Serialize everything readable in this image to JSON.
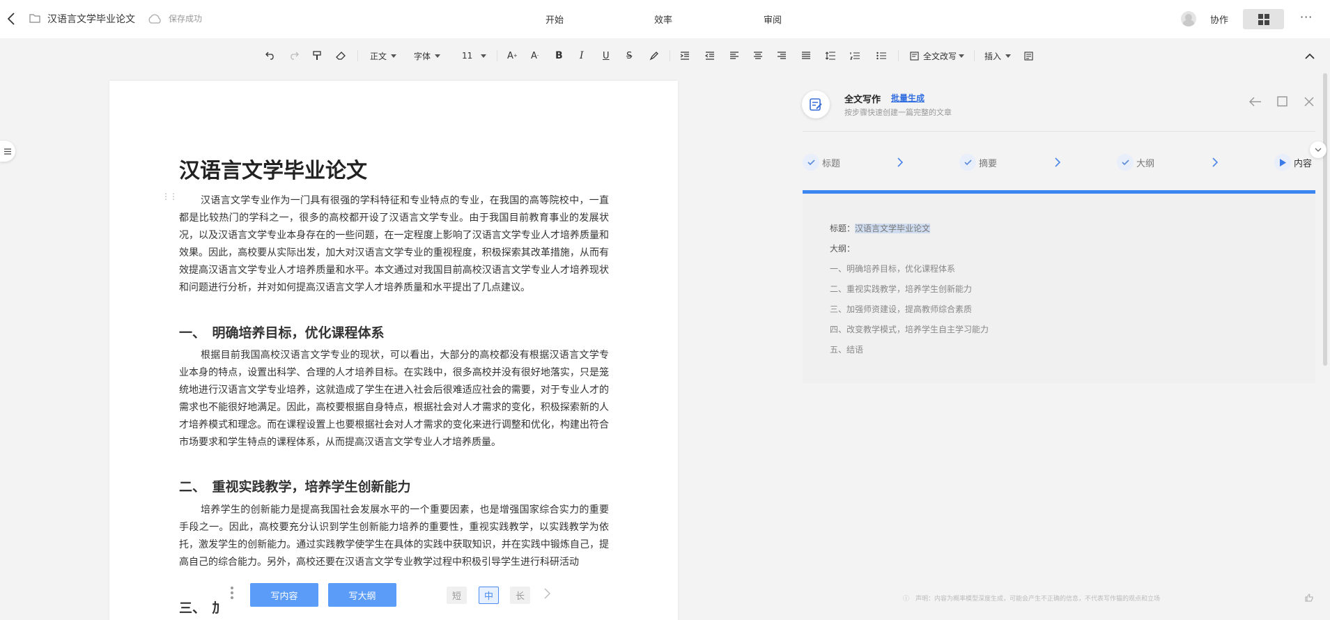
{
  "topbar": {
    "doc_title": "汉语言文学毕业论文",
    "save_status": "保存成功",
    "tabs": [
      "开始",
      "效率",
      "审阅"
    ],
    "collab": "协作"
  },
  "toolbar": {
    "style": "正文",
    "font": "字体",
    "size": "11",
    "rewrite": "全文改写",
    "insert": "插入"
  },
  "document": {
    "title": "汉语言文学毕业论文",
    "intro": "汉语言文学专业作为一门具有很强的学科特征和专业特点的专业，在我国的高等院校中，一直都是比较热门的学科之一，很多的高校都开设了汉语言文学专业。由于我国目前教育事业的发展状况，以及汉语言文学专业本身存在的一些问题，在一定程度上影响了汉语言文学专业人才培养质量和效果。因此，高校要从实际出发，加大对汉语言文学专业的重视程度，积极探索其改革措施，从而有效提高汉语言文学专业人才培养质量和水平。本文通过对我国目前高校汉语言文学专业人才培养现状和问题进行分析，并对如何提高汉语言文学人才培养质量和水平提出了几点建议。",
    "sec1_title": "一、　明确培养目标，优化课程体系",
    "sec1_text": "根据目前我国高校汉语言文学专业的现状，可以看出，大部分的高校都没有根据汉语言文学专业本身的特点，设置出科学、合理的人才培养目标。在实践中，很多高校并没有很好地落实，只是笼统地进行汉语言文学专业培养，这就造成了学生在进入社会后很难适应社会的需要，对于专业人才的需求也不能很好地满足。因此，高校要根据自身特点，根据社会对人才需求的变化，积极探索新的人才培养模式和理念。而在课程设置上也要根据社会对人才需求的变化来进行调整和优化，构建出符合市场要求和学生特点的课程体系，从而提高汉语言文学专业人才培养质量。",
    "sec2_title": "二、　重视实践教学，培养学生创新能力",
    "sec2_text": "培养学生的创新能力是提高我国社会发展水平的一个重要因素，也是增强国家综合实力的重要手段之一。因此，高校要充分认识到学生创新能力培养的重要性，重视实践教学，以实践教学为依托，激发学生的创新能力。通过实践教学使学生在具体的实践中获取知识，并在实践中锻炼自己，提高自己的综合能力。另外，高校还要在汉语言文学专业教学过程中积极引导学生进行科研活动",
    "sec3_title": "三、　加"
  },
  "float_bar": {
    "write_content": "写内容",
    "write_outline": "写大纲",
    "short": "短",
    "medium": "中",
    "long": "长"
  },
  "panel": {
    "title": "全文写作",
    "link": "批量生成",
    "subtitle": "按步骤快速创建一篇完整的文章",
    "steps": [
      "标题",
      "摘要",
      "大纲",
      "内容"
    ],
    "title_label": "标题：",
    "title_value": "汉语言文学毕业论文",
    "outline_label": "大纲：",
    "outline_items": [
      "一、明确培养目标，优化课程体系",
      "二、重视实践教学，培养学生创新能力",
      "三、加强师资建设，提高教师综合素质",
      "四、改变教学模式，培养学生自主学习能力",
      "五、结语"
    ],
    "disclaimer": "声明：内容为概率模型深度生成，可能会产生不正确的信息，不代表写作猫的观点和立场"
  }
}
